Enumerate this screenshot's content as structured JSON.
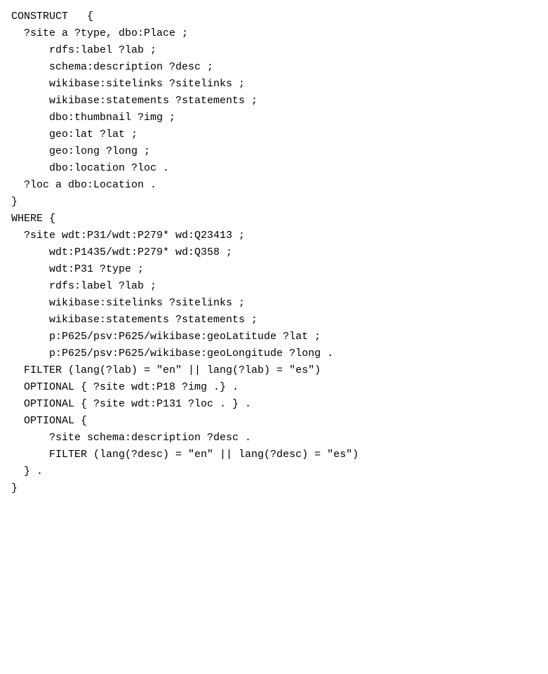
{
  "code": {
    "lines": [
      "CONSTRUCT   {",
      "  ?site a ?type, dbo:Place ;",
      "      rdfs:label ?lab ;",
      "      schema:description ?desc ;",
      "      wikibase:sitelinks ?sitelinks ;",
      "      wikibase:statements ?statements ;",
      "      dbo:thumbnail ?img ;",
      "      geo:lat ?lat ;",
      "      geo:long ?long ;",
      "      dbo:location ?loc .",
      "  ?loc a dbo:Location .",
      "}",
      "WHERE {",
      "  ?site wdt:P31/wdt:P279* wd:Q23413 ;",
      "      wdt:P1435/wdt:P279* wd:Q358 ;",
      "      wdt:P31 ?type ;",
      "      rdfs:label ?lab ;",
      "      wikibase:sitelinks ?sitelinks ;",
      "      wikibase:statements ?statements ;",
      "      p:P625/psv:P625/wikibase:geoLatitude ?lat ;",
      "      p:P625/psv:P625/wikibase:geoLongitude ?long .",
      "  FILTER (lang(?lab) = \"en\" || lang(?lab) = \"es\")",
      "  OPTIONAL { ?site wdt:P18 ?img .} .",
      "  OPTIONAL { ?site wdt:P131 ?loc . } .",
      "  OPTIONAL {",
      "      ?site schema:description ?desc .",
      "      FILTER (lang(?desc) = \"en\" || lang(?desc) = \"es\")",
      "  } .",
      "}"
    ]
  }
}
